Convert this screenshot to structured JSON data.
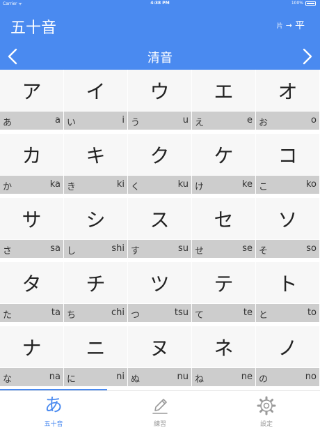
{
  "status_bar": {
    "carrier": "Carrier ᯤ",
    "time": "4:38 PM",
    "battery": "100%"
  },
  "header": {
    "title": "五十音",
    "mode_from": "片",
    "mode_arrow": "→",
    "mode_to": "平"
  },
  "section": {
    "title": "清音",
    "prev_icon": "chevron-left-icon",
    "next_icon": "chevron-right-icon"
  },
  "rows": [
    [
      {
        "katakana": "ア",
        "hiragana": "あ",
        "romaji": "a"
      },
      {
        "katakana": "イ",
        "hiragana": "い",
        "romaji": "i"
      },
      {
        "katakana": "ウ",
        "hiragana": "う",
        "romaji": "u"
      },
      {
        "katakana": "エ",
        "hiragana": "え",
        "romaji": "e"
      },
      {
        "katakana": "オ",
        "hiragana": "お",
        "romaji": "o"
      }
    ],
    [
      {
        "katakana": "カ",
        "hiragana": "か",
        "romaji": "ka"
      },
      {
        "katakana": "キ",
        "hiragana": "き",
        "romaji": "ki"
      },
      {
        "katakana": "ク",
        "hiragana": "く",
        "romaji": "ku"
      },
      {
        "katakana": "ケ",
        "hiragana": "け",
        "romaji": "ke"
      },
      {
        "katakana": "コ",
        "hiragana": "こ",
        "romaji": "ko"
      }
    ],
    [
      {
        "katakana": "サ",
        "hiragana": "さ",
        "romaji": "sa"
      },
      {
        "katakana": "シ",
        "hiragana": "し",
        "romaji": "shi"
      },
      {
        "katakana": "ス",
        "hiragana": "す",
        "romaji": "su"
      },
      {
        "katakana": "セ",
        "hiragana": "せ",
        "romaji": "se"
      },
      {
        "katakana": "ソ",
        "hiragana": "そ",
        "romaji": "so"
      }
    ],
    [
      {
        "katakana": "タ",
        "hiragana": "た",
        "romaji": "ta"
      },
      {
        "katakana": "チ",
        "hiragana": "ち",
        "romaji": "chi"
      },
      {
        "katakana": "ツ",
        "hiragana": "つ",
        "romaji": "tsu"
      },
      {
        "katakana": "テ",
        "hiragana": "て",
        "romaji": "te"
      },
      {
        "katakana": "ト",
        "hiragana": "と",
        "romaji": "to"
      }
    ],
    [
      {
        "katakana": "ナ",
        "hiragana": "な",
        "romaji": "na"
      },
      {
        "katakana": "ニ",
        "hiragana": "に",
        "romaji": "ni"
      },
      {
        "katakana": "ヌ",
        "hiragana": "ぬ",
        "romaji": "nu"
      },
      {
        "katakana": "ネ",
        "hiragana": "ね",
        "romaji": "ne"
      },
      {
        "katakana": "ノ",
        "hiragana": "の",
        "romaji": "no"
      }
    ]
  ],
  "tabs": [
    {
      "label": "五十音",
      "icon": "あ",
      "icon_name": "hiragana-a-icon",
      "active": true
    },
    {
      "label": "練習",
      "icon_name": "pencil-icon",
      "active": false
    },
    {
      "label": "設定",
      "icon_name": "gear-icon",
      "active": false
    }
  ],
  "colors": {
    "accent": "#4a8af0",
    "inactive": "#9a9a9a",
    "cell_bg": "#f7f7f7",
    "reading_bg": "#cdcdcd"
  }
}
